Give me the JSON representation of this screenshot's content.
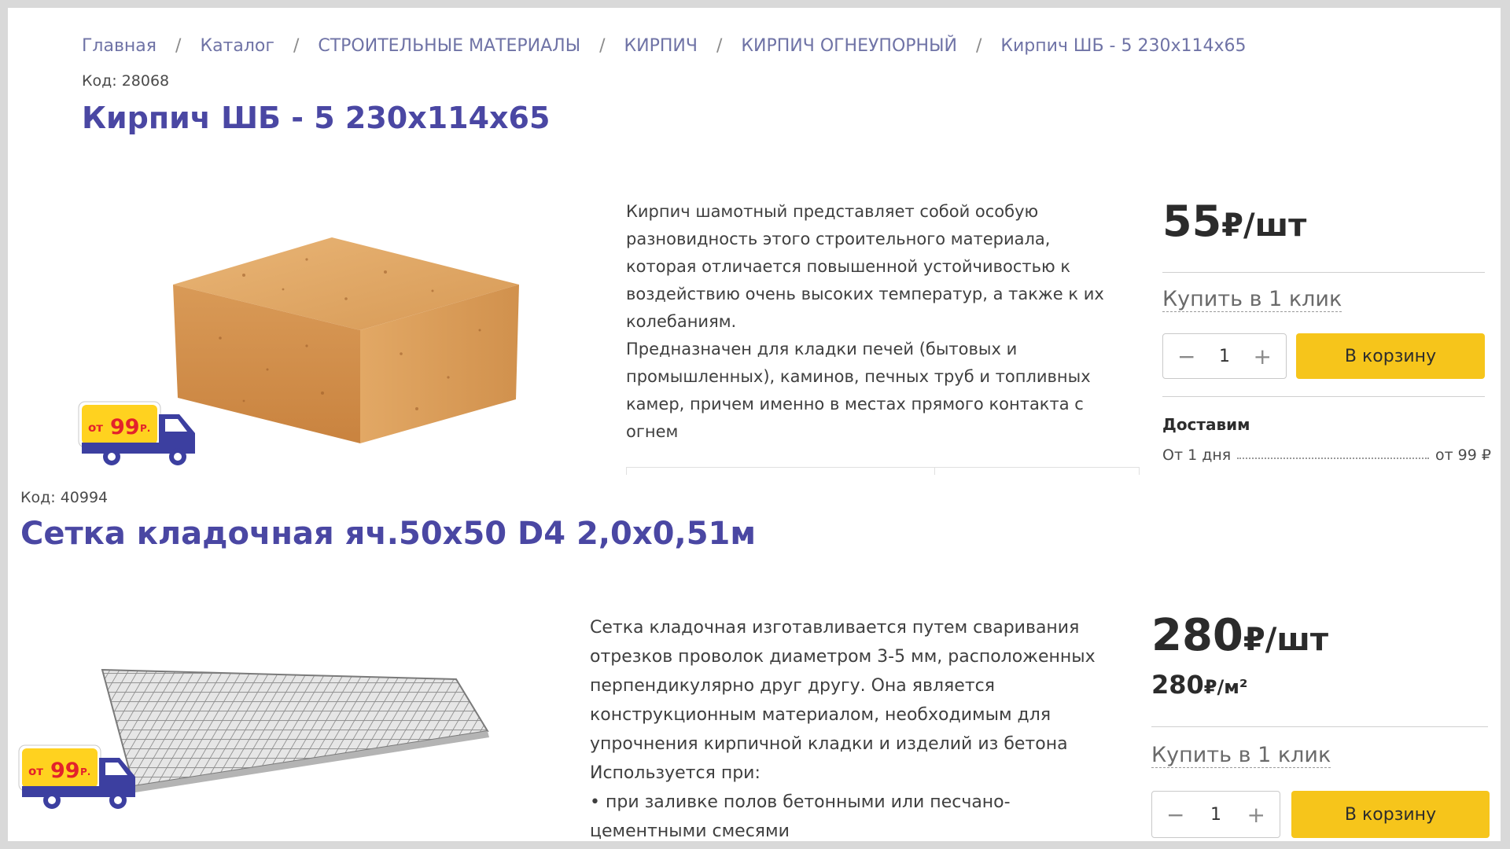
{
  "breadcrumb": [
    "Главная",
    "Каталог",
    "СТРОИТЕЛЬНЫЕ МАТЕРИАЛЫ",
    "КИРПИЧ",
    "КИРПИЧ ОГНЕУПОРНЫЙ",
    "Кирпич ШБ - 5 230х114х65"
  ],
  "breadcrumb_separator": "/",
  "products": [
    {
      "code": "Код: 28068",
      "title": "Кирпич ШБ - 5 230х114х65",
      "description": [
        "Кирпич шамотный представляет собой особую",
        "разновидность этого строительного материала,",
        "которая отличается повышенной устойчивостью к",
        "воздействию очень высоких температур, а также к их",
        "колебаниям.",
        "Предназначен для кладки печей (бытовых и",
        "промышленных), каминов, печных труб и топливных",
        "камер, причем именно в местах прямого контакта с",
        "огнем"
      ],
      "price": "55",
      "price_unit": "₽/шт",
      "buy_one_click": "Купить в 1 клик",
      "quantity": "1",
      "cart_button": "В корзину",
      "delivery_title": "Доставим",
      "delivery_term": "От 1 дня",
      "delivery_price": "от 99 ₽",
      "badge_prefix": "от",
      "badge_amount": "99",
      "badge_suffix": "Р."
    },
    {
      "code": "Код: 40994",
      "title": "Сетка кладочная яч.50х50 D4 2,0х0,51м",
      "description": [
        "Сетка кладочная изготавливается путем сваривания",
        "отрезков проволок диаметром 3-5 мм, расположенных",
        "перпендикулярно друг другу. Она является",
        "конструкционным материалом, необходимым для",
        "упрочнения кирпичной кладки и изделий из бетона",
        "Используется при:",
        "• при заливке полов бетонными или песчано-",
        "цементными смесями"
      ],
      "price": "280",
      "price_unit": "₽/шт",
      "unit_price": "280",
      "unit_price_unit": "₽/м²",
      "buy_one_click": "Купить в 1 клик",
      "quantity": "1",
      "cart_button": "В корзину",
      "badge_prefix": "от",
      "badge_amount": "99",
      "badge_suffix": "Р."
    }
  ],
  "colors": {
    "title": "#4a47a3",
    "breadcrumb": "#6f73a6",
    "button": "#f6c51b",
    "badge_yellow": "#ffd21f",
    "badge_red": "#e3222b",
    "truck_blue": "#3c3fa0"
  },
  "icons": [
    "minus-icon",
    "plus-icon",
    "delivery-truck-icon"
  ]
}
